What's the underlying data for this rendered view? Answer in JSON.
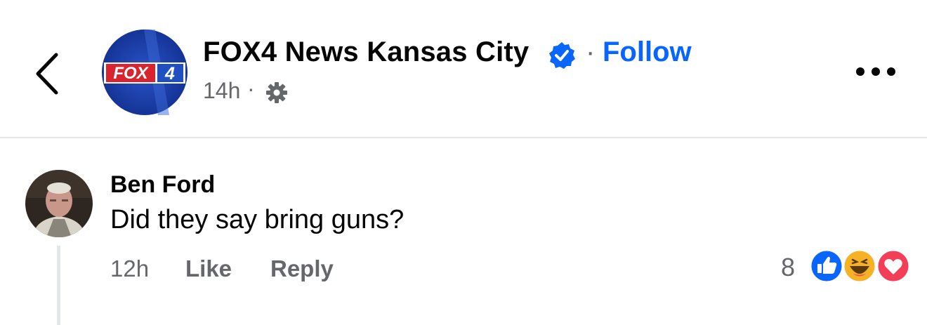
{
  "header": {
    "page_name": "FOX4 News Kansas City",
    "separator": "·",
    "follow_label": "Follow",
    "time": "14h",
    "time_separator": "·",
    "logo_text": "FOX 4",
    "icons": {
      "back": "chevron-left-icon",
      "verified": "verified-badge-icon",
      "audience": "gear-icon",
      "more": "more-dots-icon"
    }
  },
  "comment": {
    "author": "Ben Ford",
    "text": "Did they say bring guns?",
    "time": "12h",
    "like_label": "Like",
    "reply_label": "Reply",
    "reaction_count": "8",
    "reactions": [
      "like-reaction-icon",
      "haha-reaction-icon",
      "love-reaction-icon"
    ]
  },
  "colors": {
    "accent_blue": "#0866ff",
    "secondary_text": "#65676b",
    "divider": "#e4e6eb",
    "love_red": "#f33e58",
    "haha_yellow": "#f7b125"
  }
}
